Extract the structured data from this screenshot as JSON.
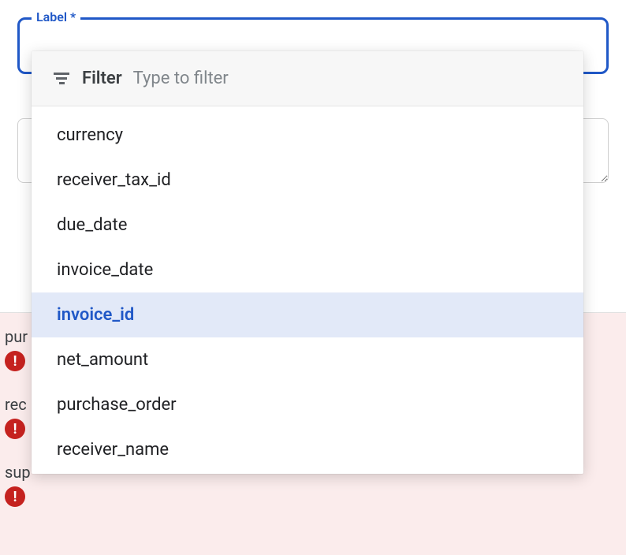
{
  "label_field": {
    "floating_label": "Label *"
  },
  "dropdown": {
    "filter_label": "Filter",
    "filter_placeholder": "Type to filter",
    "options": [
      {
        "label": "currency",
        "selected": false
      },
      {
        "label": "receiver_tax_id",
        "selected": false
      },
      {
        "label": "due_date",
        "selected": false
      },
      {
        "label": "invoice_date",
        "selected": false
      },
      {
        "label": "invoice_id",
        "selected": true
      },
      {
        "label": "net_amount",
        "selected": false
      },
      {
        "label": "purchase_order",
        "selected": false
      },
      {
        "label": "receiver_name",
        "selected": false
      }
    ]
  },
  "background_items": [
    {
      "label_prefix": "pur",
      "has_error": true
    },
    {
      "label_prefix": "rec",
      "has_error": true
    },
    {
      "label_prefix": "sup",
      "has_error": true
    }
  ],
  "colors": {
    "accent": "#2058c7",
    "error": "#c5221f",
    "error_bg": "#fbecec",
    "selected_bg": "#e2e9f8"
  }
}
